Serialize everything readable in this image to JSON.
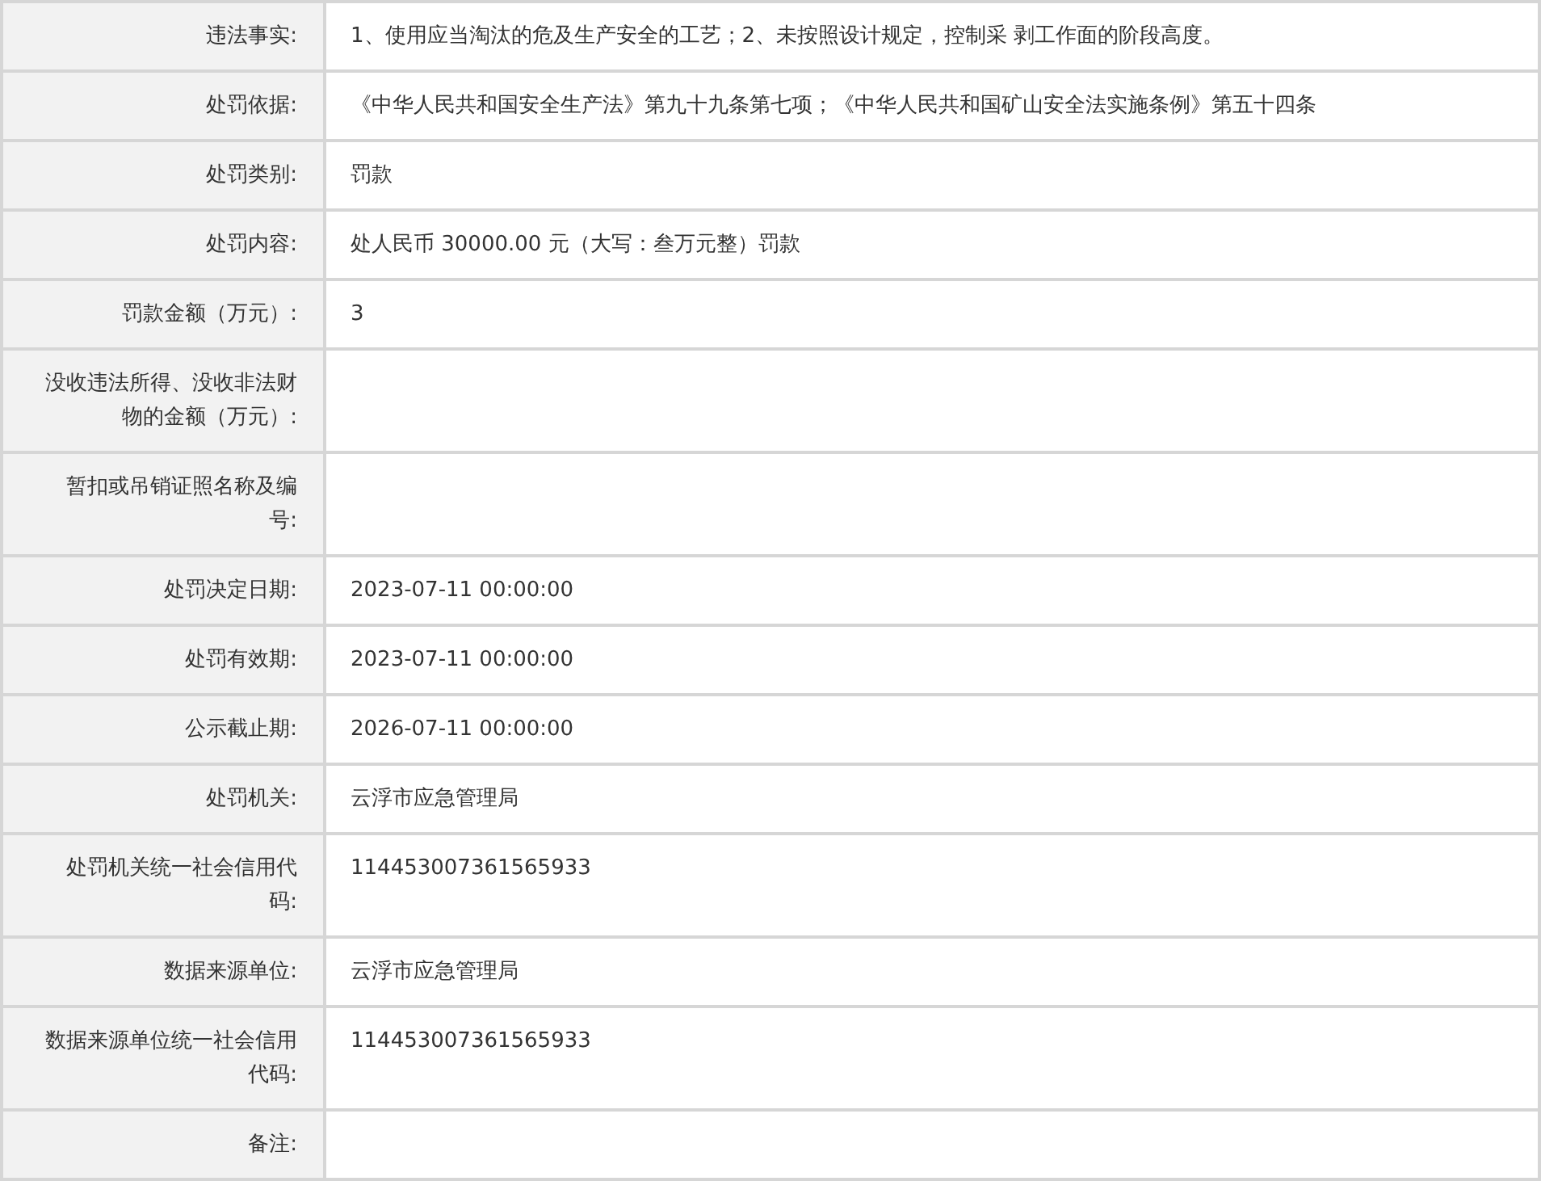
{
  "rows": [
    {
      "label": "违法事实:",
      "value": "1、使用应当淘汰的危及生产安全的工艺；2、未按照设计规定，控制采 剥工作面的阶段高度。"
    },
    {
      "label": "处罚依据:",
      "value": "《中华人民共和国安全生产法》第九十九条第七项；《中华人民共和国矿山安全法实施条例》第五十四条"
    },
    {
      "label": "处罚类别:",
      "value": "罚款"
    },
    {
      "label": "处罚内容:",
      "value": "处人民币 30000.00 元（大写：叁万元整）罚款"
    },
    {
      "label": "罚款金额（万元）:",
      "value": "3"
    },
    {
      "label": "没收违法所得、没收非法财物的金额（万元）:"
    },
    {
      "label": "暂扣或吊销证照名称及编号:"
    },
    {
      "label": "处罚决定日期:",
      "value": "2023-07-11 00:00:00"
    },
    {
      "label": "处罚有效期:",
      "value": "2023-07-11 00:00:00"
    },
    {
      "label": "公示截止期:",
      "value": "2026-07-11 00:00:00"
    },
    {
      "label": "处罚机关:",
      "value": "云浮市应急管理局"
    },
    {
      "label": "处罚机关统一社会信用代码:",
      "value": "114453007361565933"
    },
    {
      "label": "数据来源单位:",
      "value": "云浮市应急管理局"
    },
    {
      "label": "数据来源单位统一社会信用代码:",
      "value": "114453007361565933"
    },
    {
      "label": "备注:"
    }
  ]
}
